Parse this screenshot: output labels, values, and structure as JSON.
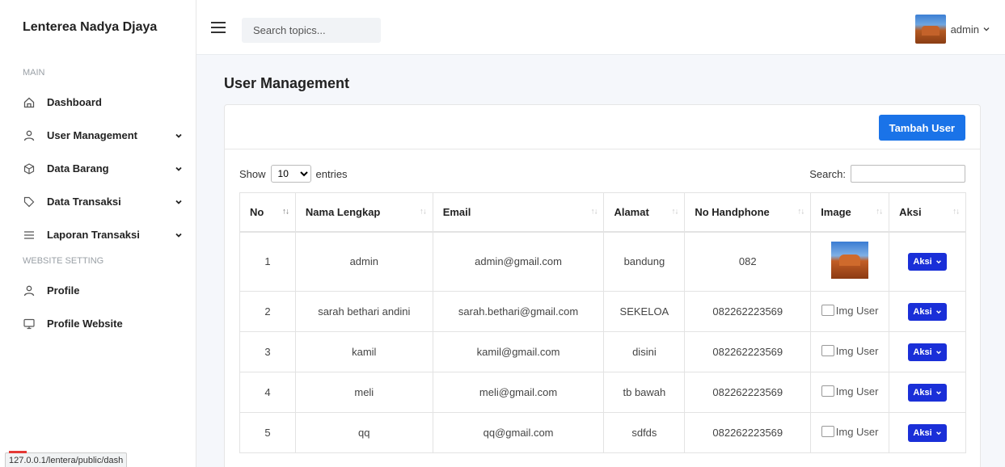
{
  "brand": "Lenterea Nadya Djaya",
  "sidebar": {
    "section_main": "MAIN",
    "section_website": "WEBSITE SETTING",
    "items": [
      {
        "label": "Dashboard",
        "icon": "home-icon"
      },
      {
        "label": "User Management",
        "icon": "user-icon"
      },
      {
        "label": "Data Barang",
        "icon": "box-icon"
      },
      {
        "label": "Data Transaksi",
        "icon": "tag-icon"
      },
      {
        "label": "Laporan Transaksi",
        "icon": "list-icon"
      }
    ],
    "web_items": [
      {
        "label": "Profile",
        "icon": "user-icon"
      },
      {
        "label": "Profile Website",
        "icon": "monitor-icon"
      }
    ]
  },
  "topbar": {
    "search_placeholder": "Search topics...",
    "user_name": "admin"
  },
  "page_title": "User Management",
  "add_button": "Tambah User",
  "datatable": {
    "show_label": "Show",
    "entries_value": "10",
    "entries_label": "entries",
    "search_label": "Search:"
  },
  "table": {
    "headers": [
      "No",
      "Nama Lengkap",
      "Email",
      "Alamat",
      "No Handphone",
      "Image",
      "Aksi"
    ],
    "rows": [
      {
        "no": "1",
        "nama": "admin",
        "email": "admin@gmail.com",
        "alamat": "bandung",
        "hp": "082",
        "image": ""
      },
      {
        "no": "2",
        "nama": "sarah bethari andini",
        "email": "sarah.bethari@gmail.com",
        "alamat": "SEKELOA",
        "hp": "082262223569",
        "image": "Img User"
      },
      {
        "no": "3",
        "nama": "kamil",
        "email": "kamil@gmail.com",
        "alamat": "disini",
        "hp": "082262223569",
        "image": "Img User"
      },
      {
        "no": "4",
        "nama": "meli",
        "email": "meli@gmail.com",
        "alamat": "tb bawah",
        "hp": "082262223569",
        "image": "Img User"
      },
      {
        "no": "5",
        "nama": "qq",
        "email": "qq@gmail.com",
        "alamat": "sdfds",
        "hp": "082262223569",
        "image": "Img User"
      }
    ],
    "action_label": "Aksi"
  },
  "status_url": "127.0.0.1/lentera/public/dash"
}
